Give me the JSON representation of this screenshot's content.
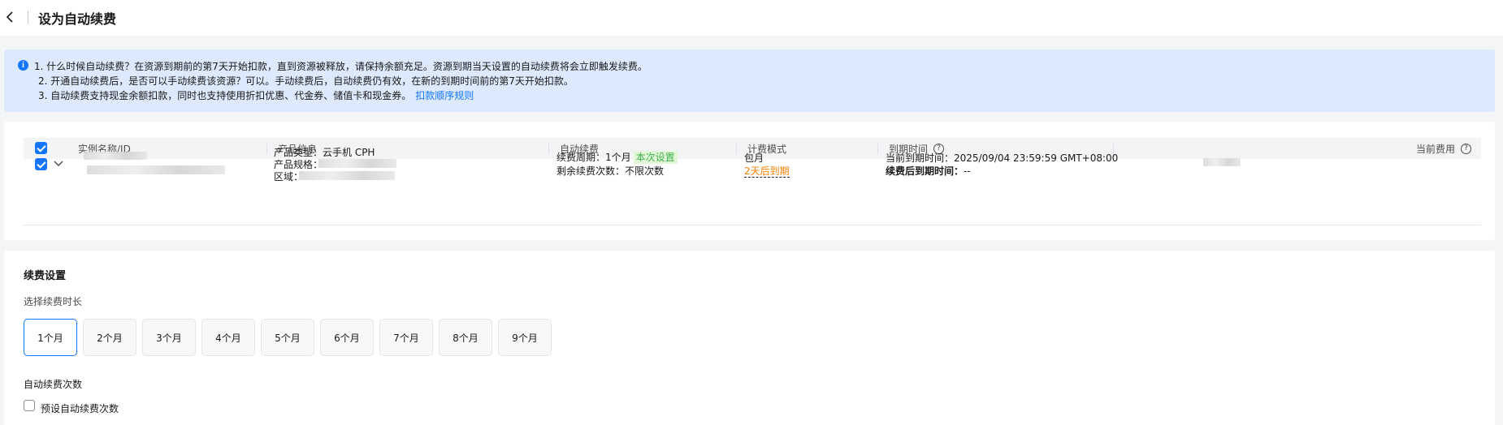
{
  "header": {
    "title": "设为自动续费"
  },
  "notice": {
    "line1": "1. 什么时候自动续费？在资源到期前的第7天开始扣款，直到资源被释放，请保持余额充足。资源到期当天设置的自动续费将会立即触发续费。",
    "line2": "2. 开通自动续费后，是否可以手动续费该资源？可以。手动续费后，自动续费仍有效，在新的到期时间前的第7天开始扣款。",
    "line3": "3. 自动续费支持现金余额扣款，同时也支持使用折扣优惠、代金券、储值卡和现金券。",
    "link": "扣款顺序规则"
  },
  "table": {
    "headers": {
      "instance": "实例名称/ID",
      "product": "产品信息",
      "auto_renew": "自动续费",
      "billing": "计费模式",
      "expiry": "到期时间",
      "cost": "当前费用"
    },
    "row": {
      "product_type": "产品类型：云手机 CPH",
      "product_spec": "产品规格：",
      "region": "区域：",
      "renew_cycle": "续费周期：1个月",
      "renew_tag": "本次设置",
      "remaining": "剩余续费次数：不限次数",
      "billing_mode": "包月",
      "expire_soon": "2天后到期",
      "current_expiry": "当前到期时间：2025/09/04 23:59:59 GMT+08:00",
      "after_renew_label": "续费后到期时间：",
      "after_renew_value": "--"
    }
  },
  "settings": {
    "title": "续费设置",
    "duration_label": "选择续费时长",
    "durations": [
      "1个月",
      "2个月",
      "3个月",
      "4个月",
      "5个月",
      "6个月",
      "7个月",
      "8个月",
      "9个月"
    ],
    "selected_index": 0,
    "count_label": "自动续费次数",
    "preset_checkbox": "预设自动续费次数"
  },
  "colors": {
    "primary": "#1476ff",
    "notice_bg": "#dde9fd",
    "warning": "#ff7f00",
    "success": "#3db24c"
  },
  "icons": {
    "back": "chevron-left-icon",
    "info": "info-icon",
    "help": "question-circle-icon",
    "expand": "chevron-down-icon"
  }
}
